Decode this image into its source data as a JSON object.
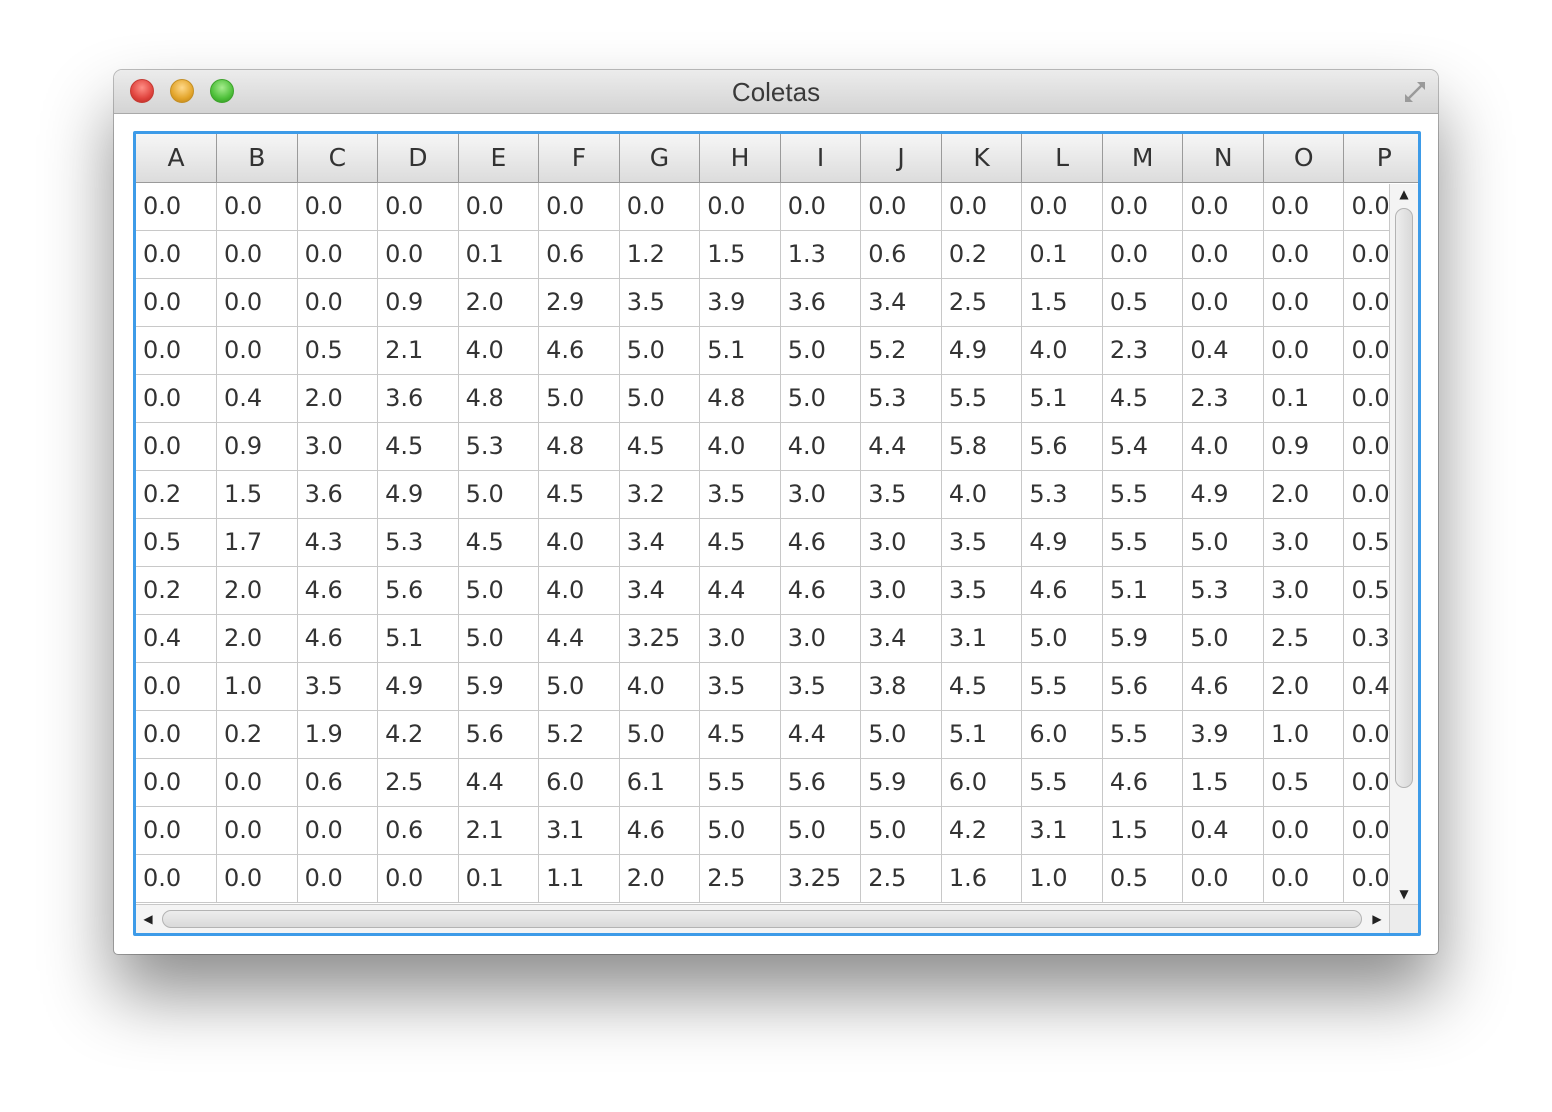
{
  "window": {
    "title": "Coletas"
  },
  "table": {
    "columns": [
      "A",
      "B",
      "C",
      "D",
      "E",
      "F",
      "G",
      "H",
      "I",
      "J",
      "K",
      "L",
      "M",
      "N",
      "O",
      "P"
    ],
    "rows": [
      [
        "0.0",
        "0.0",
        "0.0",
        "0.0",
        "0.0",
        "0.0",
        "0.0",
        "0.0",
        "0.0",
        "0.0",
        "0.0",
        "0.0",
        "0.0",
        "0.0",
        "0.0",
        "0.0"
      ],
      [
        "0.0",
        "0.0",
        "0.0",
        "0.0",
        "0.1",
        "0.6",
        "1.2",
        "1.5",
        "1.3",
        "0.6",
        "0.2",
        "0.1",
        "0.0",
        "0.0",
        "0.0",
        "0.0"
      ],
      [
        "0.0",
        "0.0",
        "0.0",
        "0.9",
        "2.0",
        "2.9",
        "3.5",
        "3.9",
        "3.6",
        "3.4",
        "2.5",
        "1.5",
        "0.5",
        "0.0",
        "0.0",
        "0.0"
      ],
      [
        "0.0",
        "0.0",
        "0.5",
        "2.1",
        "4.0",
        "4.6",
        "5.0",
        "5.1",
        "5.0",
        "5.2",
        "4.9",
        "4.0",
        "2.3",
        "0.4",
        "0.0",
        "0.0"
      ],
      [
        "0.0",
        "0.4",
        "2.0",
        "3.6",
        "4.8",
        "5.0",
        "5.0",
        "4.8",
        "5.0",
        "5.3",
        "5.5",
        "5.1",
        "4.5",
        "2.3",
        "0.1",
        "0.0"
      ],
      [
        "0.0",
        "0.9",
        "3.0",
        "4.5",
        "5.3",
        "4.8",
        "4.5",
        "4.0",
        "4.0",
        "4.4",
        "5.8",
        "5.6",
        "5.4",
        "4.0",
        "0.9",
        "0.0"
      ],
      [
        "0.2",
        "1.5",
        "3.6",
        "4.9",
        "5.0",
        "4.5",
        "3.2",
        "3.5",
        "3.0",
        "3.5",
        "4.0",
        "5.3",
        "5.5",
        "4.9",
        "2.0",
        "0.0"
      ],
      [
        "0.5",
        "1.7",
        "4.3",
        "5.3",
        "4.5",
        "4.0",
        "3.4",
        "4.5",
        "4.6",
        "3.0",
        "3.5",
        "4.9",
        "5.5",
        "5.0",
        "3.0",
        "0.5"
      ],
      [
        "0.2",
        "2.0",
        "4.6",
        "5.6",
        "5.0",
        "4.0",
        "3.4",
        "4.4",
        "4.6",
        "3.0",
        "3.5",
        "4.6",
        "5.1",
        "5.3",
        "3.0",
        "0.5"
      ],
      [
        "0.4",
        "2.0",
        "4.6",
        "5.1",
        "5.0",
        "4.4",
        "3.25",
        "3.0",
        "3.0",
        "3.4",
        "3.1",
        "5.0",
        "5.9",
        "5.0",
        "2.5",
        "0.3"
      ],
      [
        "0.0",
        "1.0",
        "3.5",
        "4.9",
        "5.9",
        "5.0",
        "4.0",
        "3.5",
        "3.5",
        "3.8",
        "4.5",
        "5.5",
        "5.6",
        "4.6",
        "2.0",
        "0.4"
      ],
      [
        "0.0",
        "0.2",
        "1.9",
        "4.2",
        "5.6",
        "5.2",
        "5.0",
        "4.5",
        "4.4",
        "5.0",
        "5.1",
        "6.0",
        "5.5",
        "3.9",
        "1.0",
        "0.0"
      ],
      [
        "0.0",
        "0.0",
        "0.6",
        "2.5",
        "4.4",
        "6.0",
        "6.1",
        "5.5",
        "5.6",
        "5.9",
        "6.0",
        "5.5",
        "4.6",
        "1.5",
        "0.5",
        "0.0"
      ],
      [
        "0.0",
        "0.0",
        "0.0",
        "0.6",
        "2.1",
        "3.1",
        "4.6",
        "5.0",
        "5.0",
        "5.0",
        "4.2",
        "3.1",
        "1.5",
        "0.4",
        "0.0",
        "0.0"
      ],
      [
        "0.0",
        "0.0",
        "0.0",
        "0.0",
        "0.1",
        "1.1",
        "2.0",
        "2.5",
        "3.25",
        "2.5",
        "1.6",
        "1.0",
        "0.5",
        "0.0",
        "0.0",
        "0.0"
      ]
    ]
  },
  "icons": {
    "close": "close-icon",
    "minimize": "minimize-icon",
    "zoom": "zoom-icon",
    "fullscreen": "fullscreen-icon"
  },
  "colors": {
    "focus_ring": "#3d9be8",
    "close": "#e0443e",
    "minimize": "#e3a52b",
    "zoom": "#4ec03a"
  }
}
